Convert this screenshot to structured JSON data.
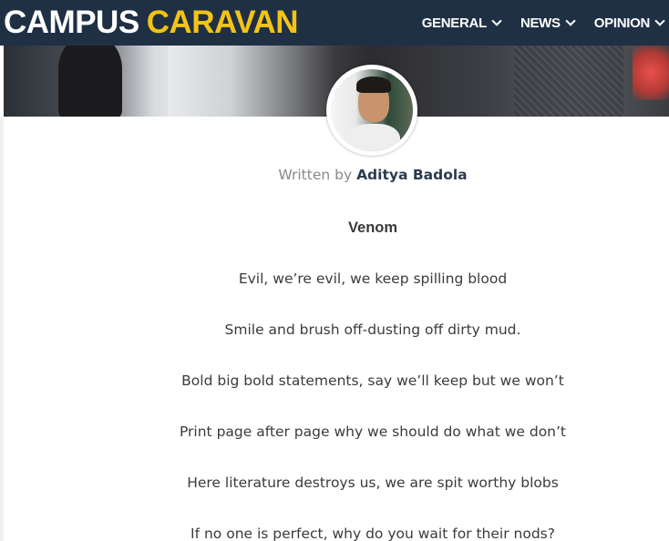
{
  "header": {
    "logo_part1": "CAMPUS",
    "logo_part2": "CARAVAN",
    "nav": [
      {
        "label": "GENERAL"
      },
      {
        "label": "NEWS"
      },
      {
        "label": "OPINION"
      }
    ],
    "colors": {
      "navbar": "#1f3044",
      "logo_accent": "#f3c316"
    }
  },
  "author": {
    "prefix": "Written by",
    "name": "Aditya Badola"
  },
  "poem": {
    "title": "Venom",
    "lines": [
      "Evil, we’re evil, we keep spilling blood",
      "Smile and brush off-dusting off dirty mud.",
      "Bold big bold statements, say we’ll keep but we won’t",
      "Print page after page why we should do what we don’t",
      "Here literature destroys us, we are spit worthy blobs",
      "If no one is perfect, why do you wait for their nods?"
    ]
  }
}
